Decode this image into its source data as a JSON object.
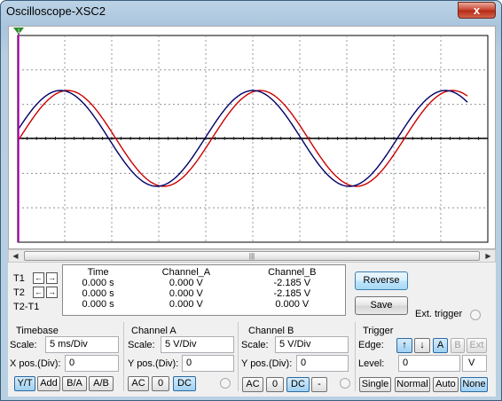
{
  "window": {
    "title": "Oscilloscope-XSC2",
    "close_glyph": "x"
  },
  "screen": {
    "background": "#ffffff",
    "grid_color": "#808080",
    "channel_a_color": "#cc0000",
    "channel_b_color": "#000066",
    "cursor1_color": "#cc00cc",
    "cursor1_tag": "1"
  },
  "cursors": {
    "t1_label": "T1",
    "t2_label": "T2",
    "diff_label": "T2-T1",
    "left_arrow": "←",
    "right_arrow": "→"
  },
  "readout": {
    "headers": [
      "Time",
      "Channel_A",
      "Channel_B"
    ],
    "rows": [
      [
        "0.000 s",
        "0.000 V",
        "-2.185 V"
      ],
      [
        "0.000 s",
        "0.000 V",
        "-2.185 V"
      ],
      [
        "0.000 s",
        "0.000 V",
        "0.000 V"
      ]
    ]
  },
  "actions": {
    "reverse": "Reverse",
    "save": "Save",
    "ext_trigger": "Ext. trigger"
  },
  "timebase": {
    "title": "Timebase",
    "scale_label": "Scale:",
    "scale_value": "5 ms/Div",
    "xpos_label": "X pos.(Div):",
    "xpos_value": "0",
    "modes": [
      "Y/T",
      "Add",
      "B/A",
      "A/B"
    ]
  },
  "channel_a": {
    "title": "Channel A",
    "scale_label": "Scale:",
    "scale_value": "5  V/Div",
    "ypos_label": "Y pos.(Div):",
    "ypos_value": "0",
    "coupling": [
      "AC",
      "0",
      "DC"
    ]
  },
  "channel_b": {
    "title": "Channel B",
    "scale_label": "Scale:",
    "scale_value": "5  V/Div",
    "ypos_label": "Y pos.(Div):",
    "ypos_value": "0",
    "coupling": [
      "AC",
      "0",
      "DC",
      "-"
    ]
  },
  "trigger": {
    "title": "Trigger",
    "edge_label": "Edge:",
    "edge_rising": "↑",
    "edge_falling": "↓",
    "sources": [
      "A",
      "B",
      "Ext"
    ],
    "level_label": "Level:",
    "level_value": "0",
    "level_unit": "V",
    "modes": [
      "Single",
      "Normal",
      "Auto",
      "None"
    ]
  },
  "scrollbar": {
    "grip": "|||",
    "left": "◀",
    "right": "▶"
  }
}
